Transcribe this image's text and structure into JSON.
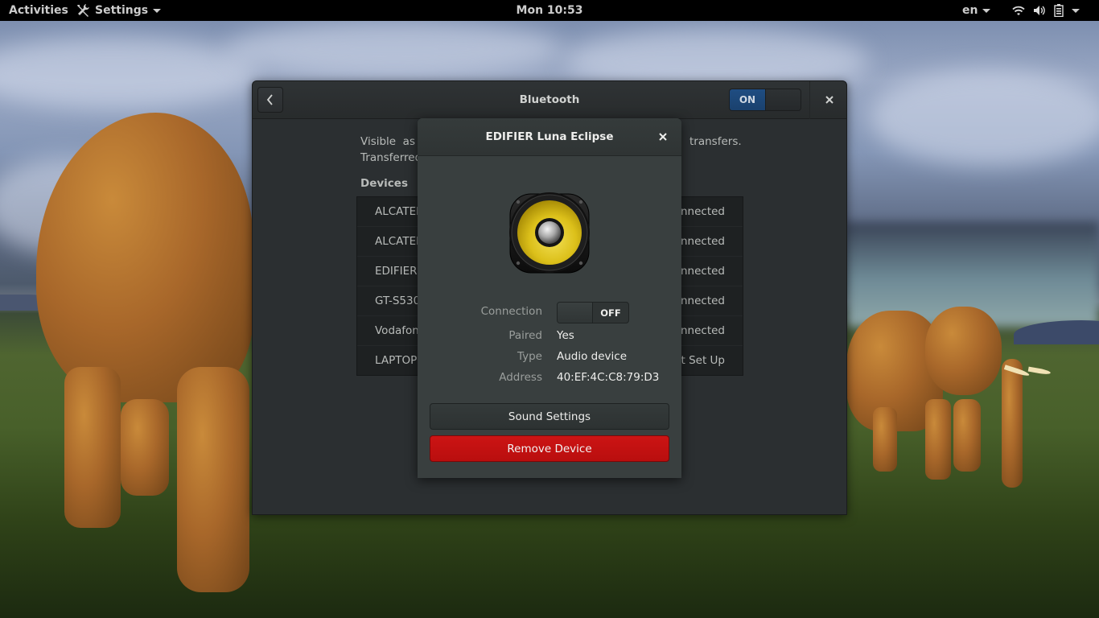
{
  "topbar": {
    "activities_label": "Activities",
    "app_menu_label": "Settings",
    "app_menu_icon": "tools-icon",
    "clock": "Mon 10:53",
    "input_language": "en",
    "status_icons": [
      "wifi-icon",
      "volume-icon",
      "battery-icon"
    ]
  },
  "window": {
    "title": "Bluetooth",
    "back_icon": "chevron-left-icon",
    "bluetooth_switch": {
      "label": "ON",
      "state": "on"
    },
    "close_icon": "close-icon",
    "visible_text_line1": "Visible  as",
    "visible_text_line1_end": "transfers.",
    "visible_text_line2": "Transferred",
    "devices_heading": "Devices",
    "devices": [
      {
        "name": "ALCATEL",
        "status": "nnected"
      },
      {
        "name": "ALCATEL",
        "status": "nnected"
      },
      {
        "name": "EDIFIER",
        "status": "nnected"
      },
      {
        "name": "GT-S530",
        "status": "nnected"
      },
      {
        "name": "Vodafon",
        "status": "nnected"
      },
      {
        "name": "LAPTOP",
        "status": "t Set Up"
      }
    ]
  },
  "device_dialog": {
    "title": "EDIFIER Luna Eclipse",
    "close_icon": "close-icon",
    "device_icon": "audio-speaker-icon",
    "connection_label": "Connection",
    "connection_switch": {
      "label": "OFF",
      "state": "off"
    },
    "paired_label": "Paired",
    "paired_value": "Yes",
    "type_label": "Type",
    "type_value": "Audio device",
    "address_label": "Address",
    "address_value": "40:EF:4C:C8:79:D3",
    "sound_settings_label": "Sound Settings",
    "remove_device_label": "Remove Device"
  },
  "colors": {
    "switch_on": "#1d4a7a",
    "destructive": "#c4100f",
    "window_bg": "#2b2f31",
    "dialog_bg": "#393f3f"
  }
}
